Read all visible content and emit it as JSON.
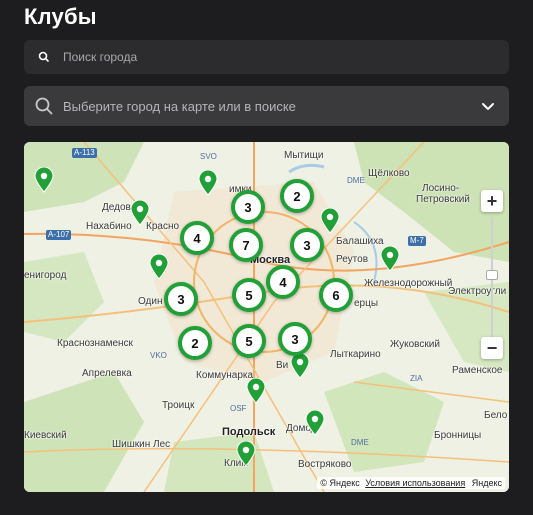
{
  "header": {
    "title": "Клубы"
  },
  "search": {
    "placeholder": "Поиск города"
  },
  "city_select": {
    "placeholder": "Выберите город на карте или в поиске"
  },
  "map": {
    "labels": [
      {
        "id": "a113",
        "text": "A-113",
        "kind": "hw"
      },
      {
        "id": "svo",
        "text": "SVO",
        "kind": "apt"
      },
      {
        "id": "mytishchi",
        "text": "Мытищи"
      },
      {
        "id": "shchelkovo",
        "text": "Щёлково"
      },
      {
        "id": "losino",
        "text": "Лосино-"
      },
      {
        "id": "petrovsky",
        "text": "Петровский"
      },
      {
        "id": "dedovsk",
        "text": "Дедовс"
      },
      {
        "id": "khimki",
        "text": "имки"
      },
      {
        "id": "nakhabino",
        "text": "Нахабино"
      },
      {
        "id": "krasnogorsk",
        "text": "Красно"
      },
      {
        "id": "a107",
        "text": "A-107",
        "kind": "hw"
      },
      {
        "id": "dme_small",
        "text": "DME",
        "kind": "apt"
      },
      {
        "id": "balashikha",
        "text": "Балашиха"
      },
      {
        "id": "m7",
        "text": "M-7",
        "kind": "hw"
      },
      {
        "id": "reutov",
        "text": "Реутов"
      },
      {
        "id": "nenigorod",
        "text": "енигород"
      },
      {
        "id": "moskva",
        "text": "Москва",
        "kind": "big"
      },
      {
        "id": "zheleznodorozhny",
        "text": "Железнодорожный"
      },
      {
        "id": "elektrougli",
        "text": "Электроугли"
      },
      {
        "id": "odin",
        "text": "Один"
      },
      {
        "id": "lyubertsy",
        "text": "ерцы"
      },
      {
        "id": "krasnoznamensk",
        "text": "Краснознаменск"
      },
      {
        "id": "vko",
        "text": "VKO",
        "kind": "apt"
      },
      {
        "id": "kommunarka",
        "text": "Коммунарка"
      },
      {
        "id": "lytkarino",
        "text": "Лыткарино"
      },
      {
        "id": "zhukovsky",
        "text": "Жуковский"
      },
      {
        "id": "aprelevka",
        "text": "Апрелевка"
      },
      {
        "id": "zia",
        "text": "ZIA",
        "kind": "apt"
      },
      {
        "id": "ramenskoe",
        "text": "Раменское"
      },
      {
        "id": "troitsk",
        "text": "Троицк"
      },
      {
        "id": "osf",
        "text": "OSF",
        "kind": "apt"
      },
      {
        "id": "vi",
        "text": "Ви"
      },
      {
        "id": "belo",
        "text": "Бело"
      },
      {
        "id": "kievsky",
        "text": "Киевский"
      },
      {
        "id": "podolsk",
        "text": "Подольск"
      },
      {
        "id": "domodedovo",
        "text": "Домод"
      },
      {
        "id": "bronnitsy",
        "text": "Бронницы"
      },
      {
        "id": "shishkin",
        "text": "Шишкин Лес"
      },
      {
        "id": "dme",
        "text": "DME",
        "kind": "apt"
      },
      {
        "id": "klimovsk",
        "text": "Клим"
      },
      {
        "id": "vostryakovo",
        "text": "Востряково"
      }
    ],
    "clusters": [
      {
        "id": "c1",
        "count": "2"
      },
      {
        "id": "c2",
        "count": "3"
      },
      {
        "id": "c3",
        "count": "4"
      },
      {
        "id": "c4",
        "count": "7"
      },
      {
        "id": "c5",
        "count": "3"
      },
      {
        "id": "c6",
        "count": "4"
      },
      {
        "id": "c7",
        "count": "5"
      },
      {
        "id": "c8",
        "count": "6"
      },
      {
        "id": "c9",
        "count": "3"
      },
      {
        "id": "c10",
        "count": "2"
      },
      {
        "id": "c11",
        "count": "5"
      },
      {
        "id": "c12",
        "count": "3"
      }
    ],
    "zoom_in": "+",
    "zoom_out": "−",
    "copyright": {
      "yandex": "© Яндекс",
      "terms": "Условия использования",
      "brand": "Яндекс"
    }
  },
  "colors": {
    "accent": "#21a038",
    "background": "#1d1d1f",
    "field": "#2c2c2e"
  }
}
